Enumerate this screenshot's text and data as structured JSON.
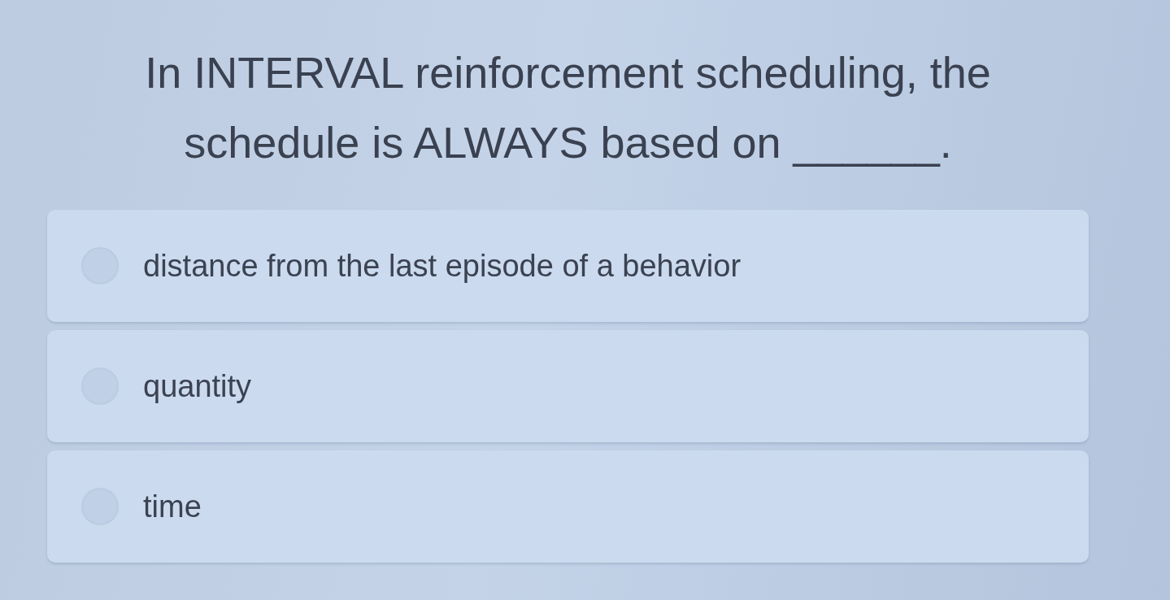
{
  "question": "In INTERVAL reinforcement scheduling, the schedule is ALWAYS based on ______.",
  "options": [
    {
      "label": "distance from the last episode of a behavior",
      "selected": false
    },
    {
      "label": "quantity",
      "selected": false
    },
    {
      "label": "time",
      "selected": false
    }
  ]
}
